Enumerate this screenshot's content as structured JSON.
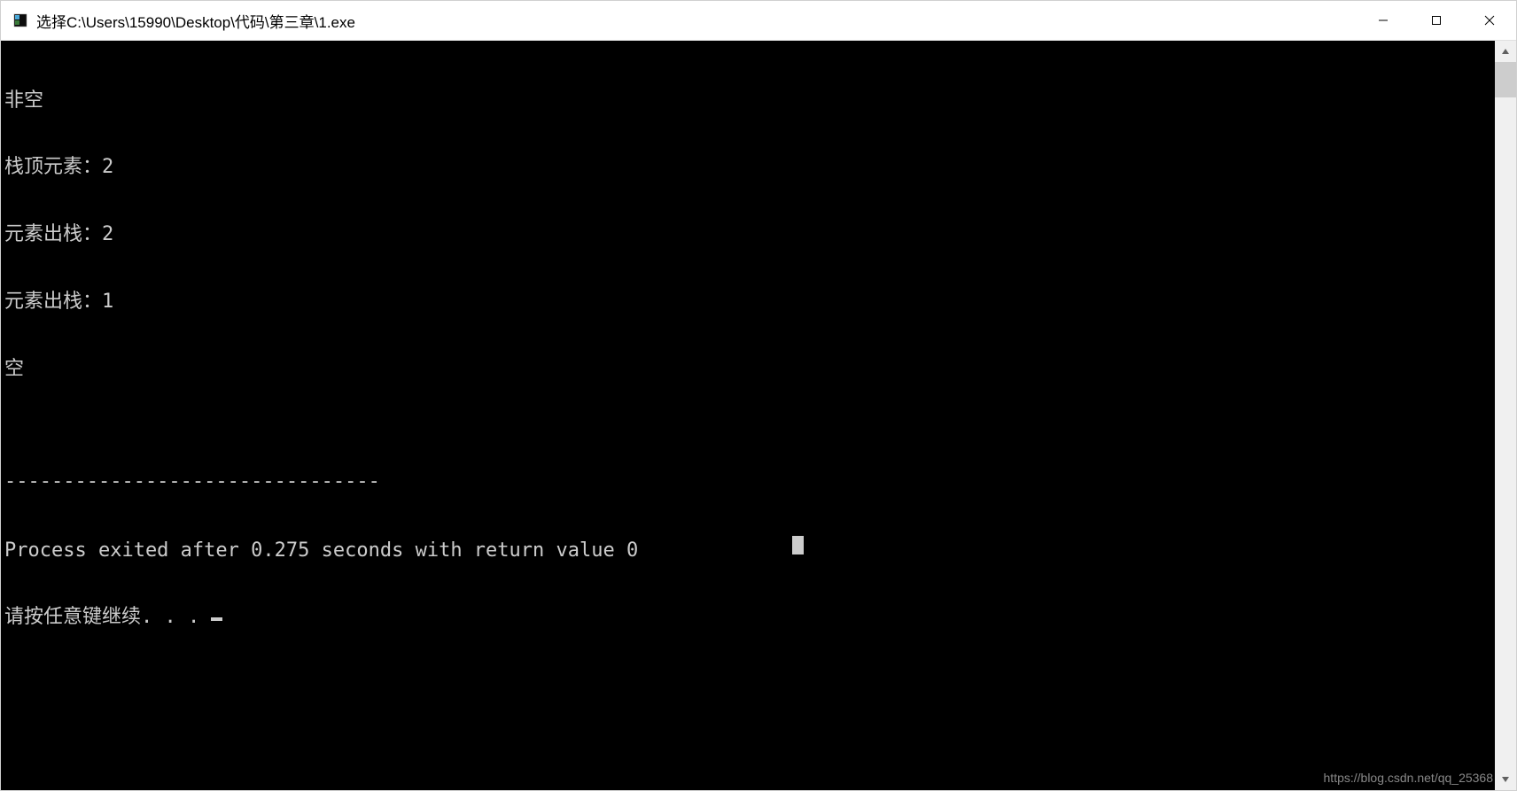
{
  "titlebar": {
    "title": "选择C:\\Users\\15990\\Desktop\\代码\\第三章\\1.exe"
  },
  "console": {
    "lines": [
      "非空",
      "栈顶元素：2",
      "元素出栈：2",
      "元素出栈：1",
      "空",
      "",
      "--------------------------------",
      "Process exited after 0.275 seconds with return value 0",
      "请按任意键继续. . . "
    ]
  },
  "watermark": "https://blog.csdn.net/qq_25368"
}
